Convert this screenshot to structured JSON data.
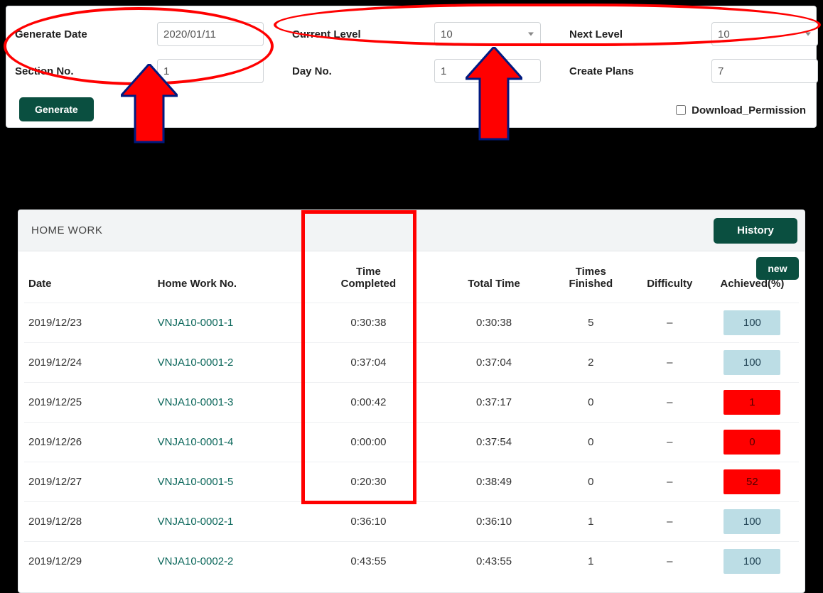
{
  "form": {
    "generate_date_label": "Generate Date",
    "generate_date_value": "2020/01/11",
    "current_level_label": "Current Level",
    "current_level_value": "10",
    "next_level_label": "Next Level",
    "next_level_value": "10",
    "section_no_label": "Section No.",
    "section_no_value": "1",
    "day_no_label": "Day No.",
    "day_no_value": "1",
    "create_plans_label": "Create Plans",
    "create_plans_value": "7",
    "generate_button": "Generate",
    "download_permission_label": "Download_Permission",
    "download_permission_checked": false
  },
  "homework": {
    "panel_title": "HOME WORK",
    "history_button": "History",
    "new_button": "new",
    "columns": {
      "date": "Date",
      "hw_no": "Home Work No.",
      "time_completed_l1": "Time",
      "time_completed_l2": "Completed",
      "total_time": "Total Time",
      "times_finished_l1": "Times",
      "times_finished_l2": "Finished",
      "difficulty": "Difficulty",
      "achieved": "Achieved(%)"
    },
    "rows": [
      {
        "date": "2019/12/23",
        "hw_no": "VNJA10-0001-1",
        "time_completed": "0:30:38",
        "total_time": "0:30:38",
        "times_finished": "5",
        "difficulty": "–",
        "achieved": "100",
        "ach_status": "good"
      },
      {
        "date": "2019/12/24",
        "hw_no": "VNJA10-0001-2",
        "time_completed": "0:37:04",
        "total_time": "0:37:04",
        "times_finished": "2",
        "difficulty": "–",
        "achieved": "100",
        "ach_status": "good"
      },
      {
        "date": "2019/12/25",
        "hw_no": "VNJA10-0001-3",
        "time_completed": "0:00:42",
        "total_time": "0:37:17",
        "times_finished": "0",
        "difficulty": "–",
        "achieved": "1",
        "ach_status": "bad"
      },
      {
        "date": "2019/12/26",
        "hw_no": "VNJA10-0001-4",
        "time_completed": "0:00:00",
        "total_time": "0:37:54",
        "times_finished": "0",
        "difficulty": "–",
        "achieved": "0",
        "ach_status": "bad"
      },
      {
        "date": "2019/12/27",
        "hw_no": "VNJA10-0001-5",
        "time_completed": "0:20:30",
        "total_time": "0:38:49",
        "times_finished": "0",
        "difficulty": "–",
        "achieved": "52",
        "ach_status": "bad"
      },
      {
        "date": "2019/12/28",
        "hw_no": "VNJA10-0002-1",
        "time_completed": "0:36:10",
        "total_time": "0:36:10",
        "times_finished": "1",
        "difficulty": "–",
        "achieved": "100",
        "ach_status": "good"
      },
      {
        "date": "2019/12/29",
        "hw_no": "VNJA10-0002-2",
        "time_completed": "0:43:55",
        "total_time": "0:43:55",
        "times_finished": "1",
        "difficulty": "–",
        "achieved": "100",
        "ach_status": "good"
      }
    ]
  },
  "colors": {
    "brand": "#0a4f40",
    "badge_good_bg": "#bcdde5",
    "badge_bad_bg": "#ff0000",
    "annotation": "#ff0000"
  }
}
